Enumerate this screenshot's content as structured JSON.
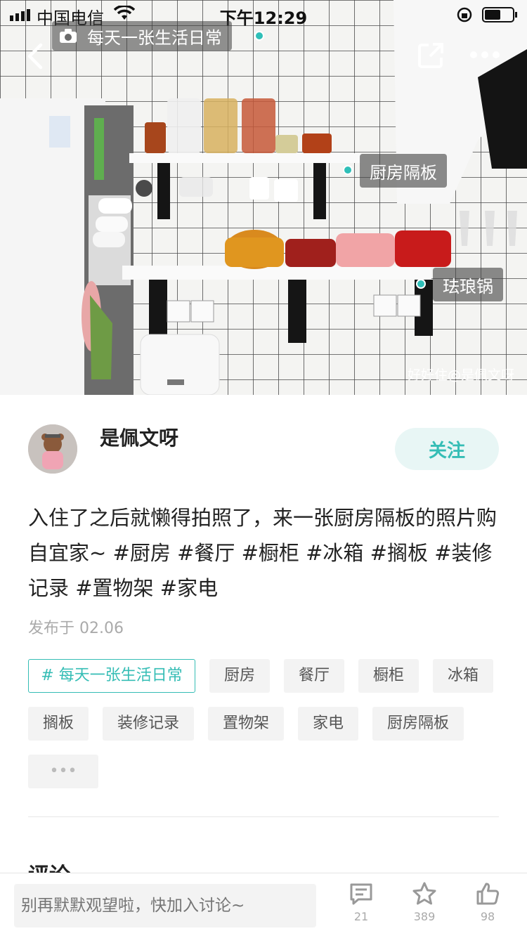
{
  "status_bar": {
    "carrier": "中国电信",
    "time": "下午12:29"
  },
  "photo": {
    "topic_chip": "每天一张生活日常",
    "tags": [
      "厨房隔板",
      "珐琅锅"
    ],
    "watermark": "好好住@是佩文呀"
  },
  "author": {
    "name": "是佩文呀",
    "follow_label": "关注"
  },
  "post": {
    "text_plain": "入住了之后就懒得拍照了，来一张厨房隔板的照片购自宜家~ ",
    "hashtags": [
      "#厨房",
      "#餐厅",
      "#橱柜",
      "#冰箱",
      "#搁板",
      "#装修记录",
      "#置物架",
      "#家电"
    ],
    "date": "发布于 02.06"
  },
  "tags": {
    "topic": "# 每天一张生活日常",
    "items": [
      "厨房",
      "餐厅",
      "橱柜",
      "冰箱",
      "搁板",
      "装修记录",
      "置物架",
      "家电",
      "厨房隔板"
    ],
    "more": "•••"
  },
  "comments": {
    "title": "评论"
  },
  "bottom_bar": {
    "input_placeholder": "别再默默观望啦，快加入讨论~",
    "comment_count": "21",
    "favorite_count": "389",
    "like_count": "98"
  },
  "colors": {
    "accent": "#35bdb5",
    "tag_dot": "#2fbfb8"
  }
}
